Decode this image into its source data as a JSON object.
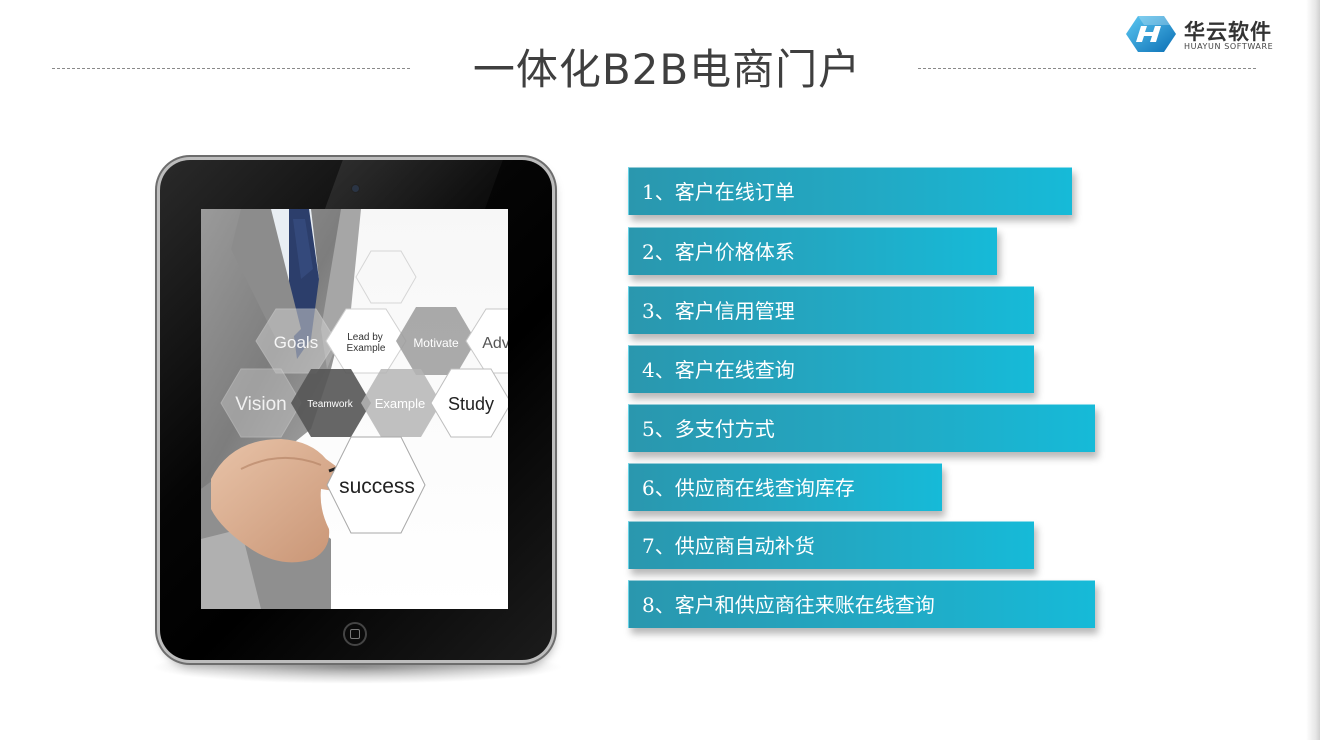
{
  "header": {
    "title": "一体化B2B电商门户"
  },
  "logo": {
    "name": "华云软件",
    "subtitle": "HUAYUN SOFTWARE",
    "icon": "huayun-logo-icon"
  },
  "tablet": {
    "screen": {
      "words": {
        "goals": "Goals",
        "lead": "Lead by",
        "example_small": "Example",
        "motivate": "Motivate",
        "adv": "Adv",
        "vision": "Vision",
        "teamwork": "Teamwork",
        "example": "Example",
        "study": "Study",
        "success": "success"
      }
    }
  },
  "features": {
    "items": [
      {
        "label": "1、客户在线订单"
      },
      {
        "label": "2、客户价格体系"
      },
      {
        "label": "3、客户信用管理"
      },
      {
        "label": "4、客户在线查询"
      },
      {
        "label": "5、多支付方式"
      },
      {
        "label": "6、供应商在线查询库存"
      },
      {
        "label": "7、供应商自动补货"
      },
      {
        "label": "8、客户和供应商往来账在线查询"
      }
    ]
  },
  "colors": {
    "bar_start": "#2a97ae",
    "bar_end": "#16bad8",
    "title": "#3f3f3f",
    "logo_blue": "#1a8fd1"
  }
}
